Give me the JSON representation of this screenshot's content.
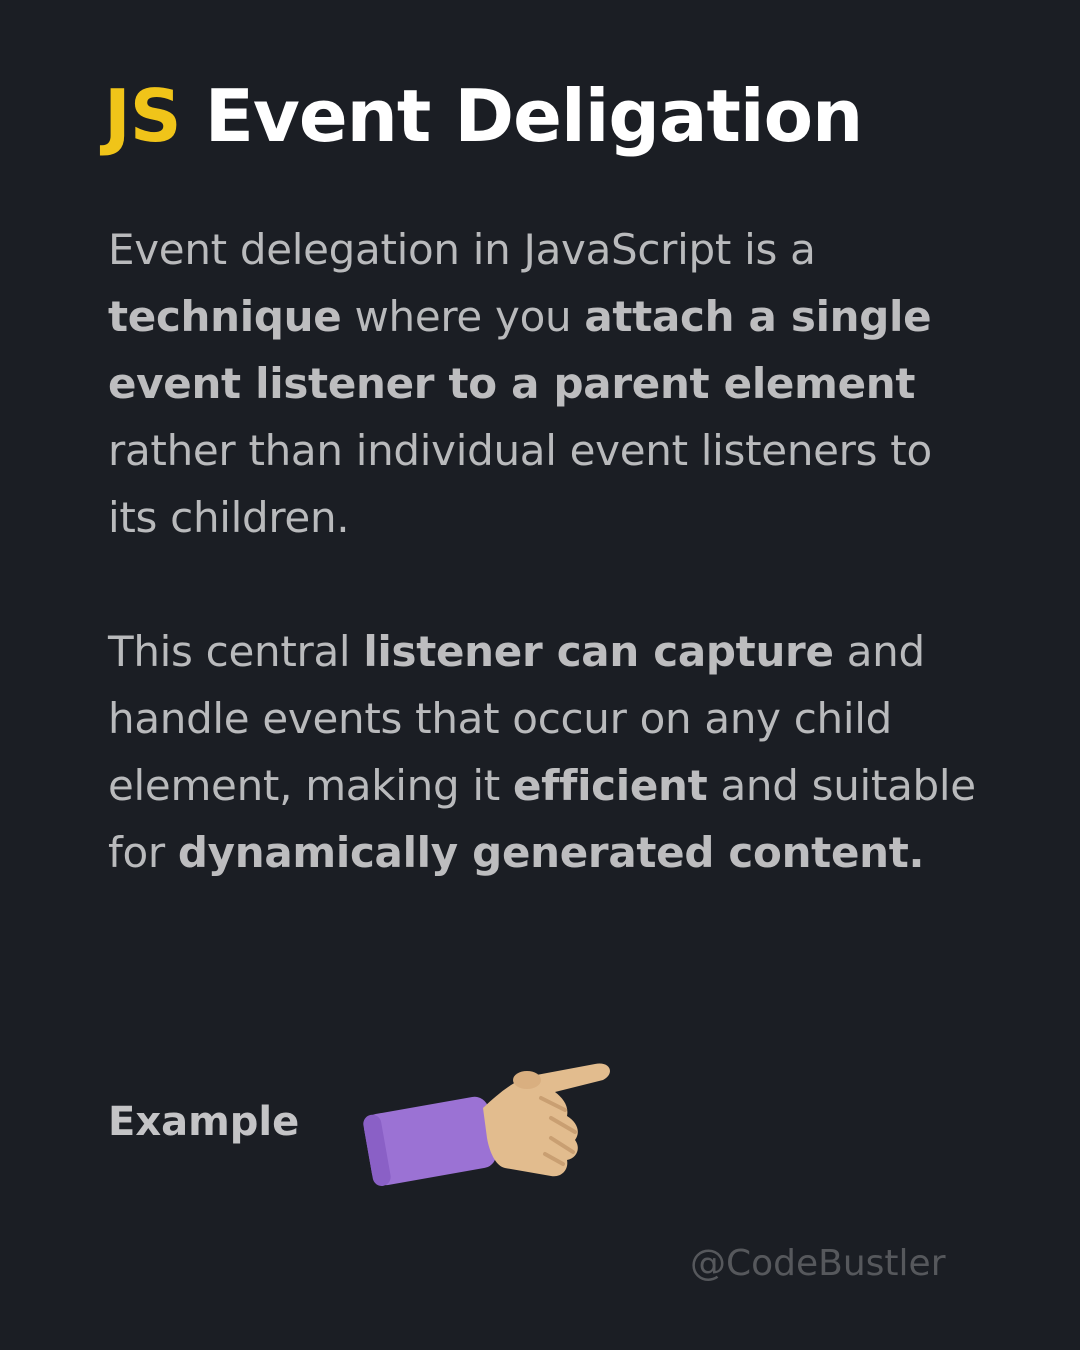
{
  "title": {
    "prefix": "JS",
    "text": " Event Deligation"
  },
  "paragraph1": [
    {
      "t": "Event delegation in JavaScript is a ",
      "b": false
    },
    {
      "t": "technique",
      "b": true
    },
    {
      "t": " where you ",
      "b": false
    },
    {
      "t": "attach a single event listener to a parent element",
      "b": true
    },
    {
      "t": " rather than individual event listeners to its children.",
      "b": false
    }
  ],
  "paragraph2": [
    {
      "t": "This central ",
      "b": false
    },
    {
      "t": "listener can capture",
      "b": true
    },
    {
      "t": " and handle events that occur on any child element, making it ",
      "b": false
    },
    {
      "t": "efficient",
      "b": true
    },
    {
      "t": " and suitable for ",
      "b": false
    },
    {
      "t": "dynamically generated content.",
      "b": true
    }
  ],
  "example_label": "Example",
  "hand_icon": "pointing-hand-icon",
  "handle": "@CodeBustler",
  "colors": {
    "background": "#1b1e24",
    "accent": "#f0c419",
    "sleeve": "#9b72d4",
    "skin": "#e2bc8e"
  }
}
